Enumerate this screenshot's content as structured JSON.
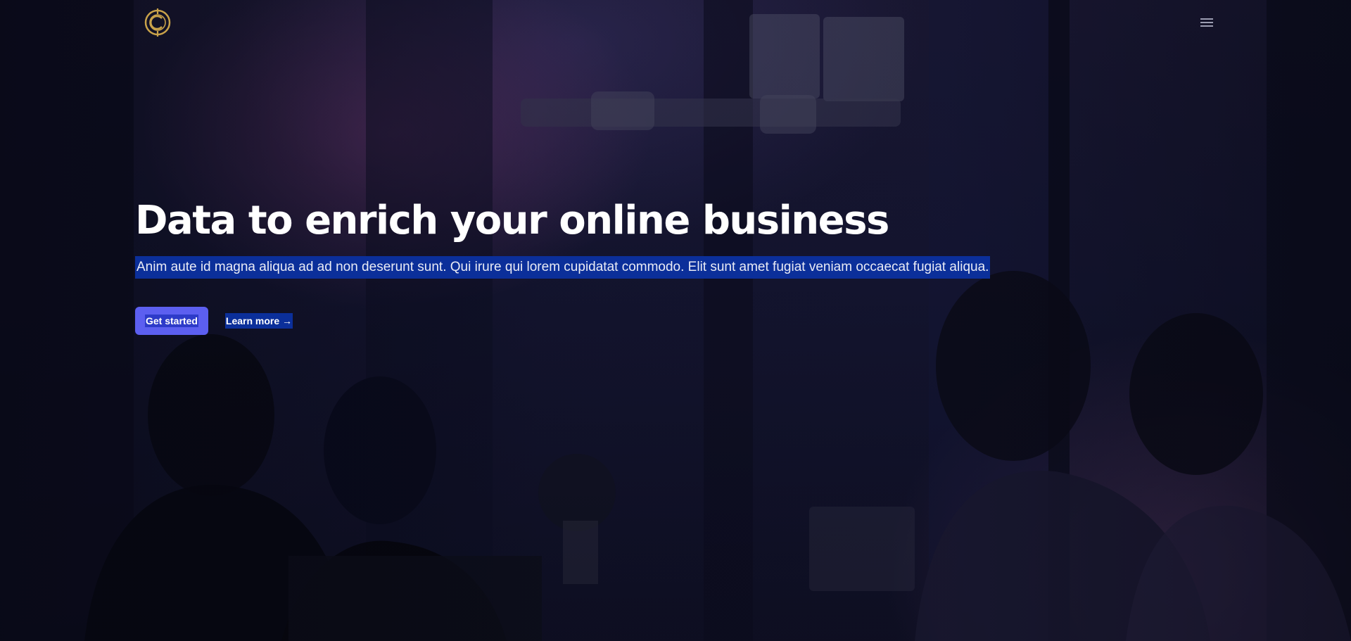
{
  "header": {
    "logo": "brand-logo",
    "menu_icon": "hamburger-menu-icon"
  },
  "hero": {
    "headline": "Data to enrich your online business",
    "subtitle": "Anim aute id magna aliqua ad ad non deserunt sunt. Qui irure qui lorem cupidatat commodo. Elit sunt amet fugiat veniam occaecat fugiat aliqua.",
    "primary_cta": "Get started",
    "secondary_cta": "Learn more →"
  },
  "colors": {
    "accent": "#5c5ff0",
    "text_selection": "#0b2f9a",
    "logo_gold": "#c9a24a"
  }
}
